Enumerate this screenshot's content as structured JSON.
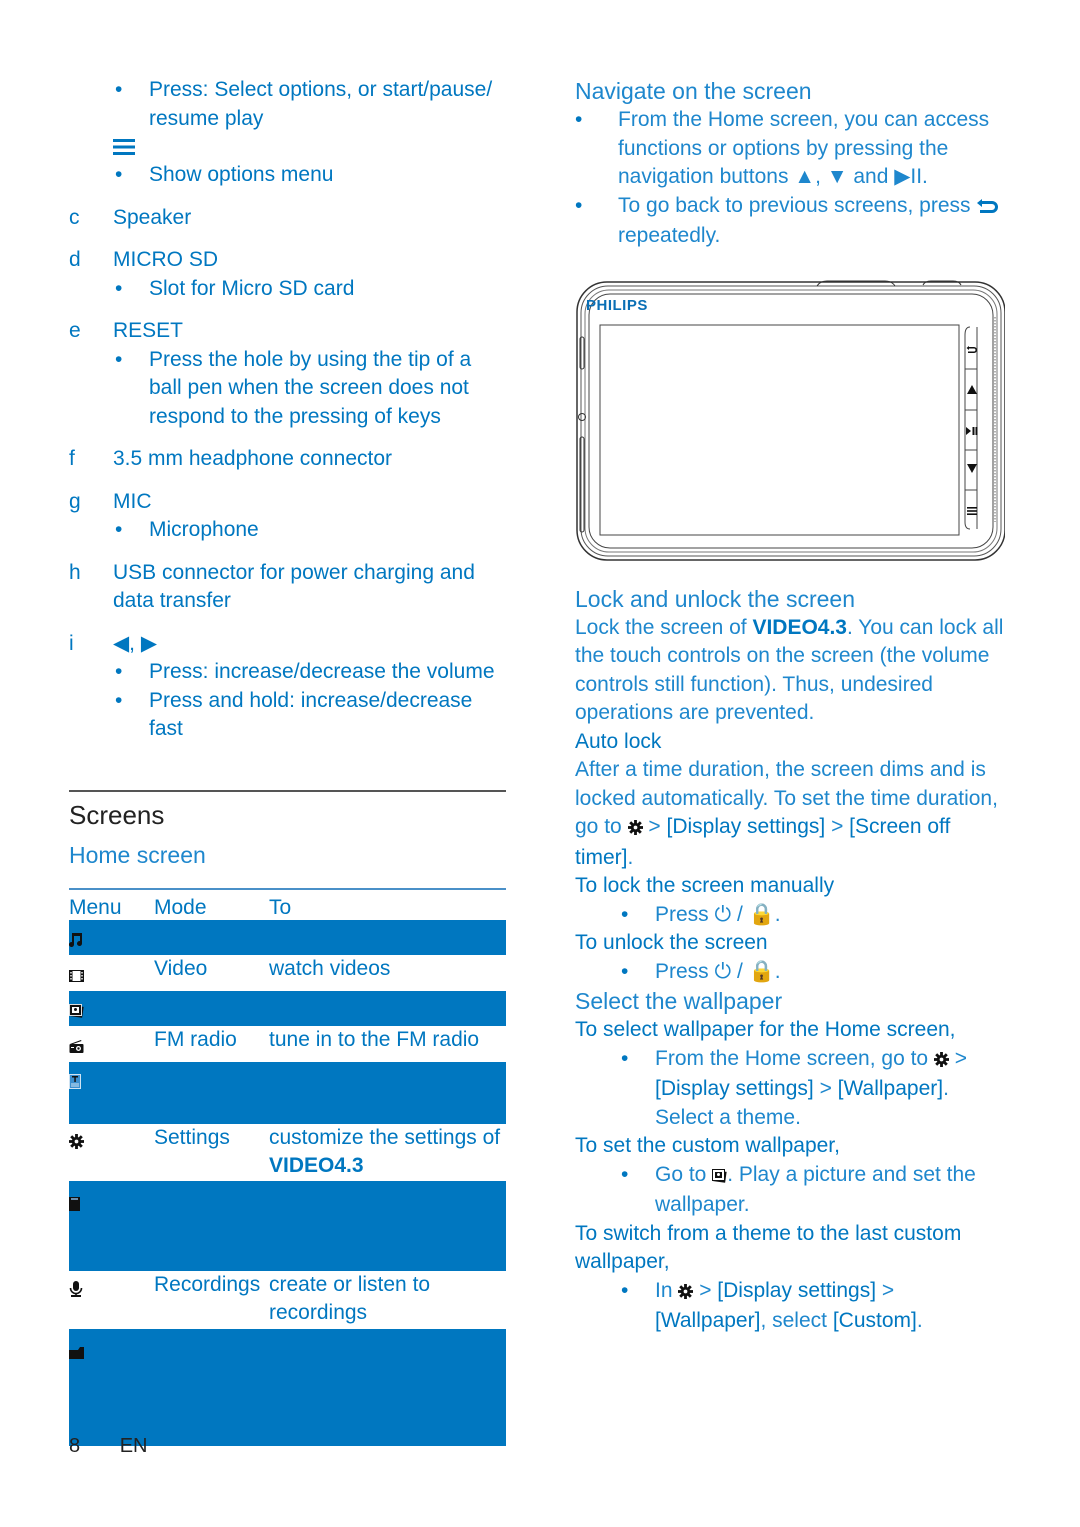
{
  "left": {
    "intro_bullets": [
      {
        "text": "Press: Select options, or start/pause/ resume play"
      }
    ],
    "menu_icon": "menu-icon",
    "menu_bullets": [
      {
        "text": "Show options menu"
      }
    ],
    "items": [
      {
        "letter": "c",
        "title": "Speaker",
        "bullets": []
      },
      {
        "letter": "d",
        "title": "MICRO SD",
        "bullets": [
          "Slot for Micro SD card"
        ]
      },
      {
        "letter": "e",
        "title": "RESET",
        "bullets": [
          "Press the hole by using the tip of a ball pen when the screen does not respond to the pressing of keys"
        ]
      },
      {
        "letter": "f",
        "title": "3.5 mm headphone connector",
        "bullets": []
      },
      {
        "letter": "g",
        "title": "MIC",
        "bullets": [
          "Microphone"
        ]
      },
      {
        "letter": "h",
        "title": "USB connector for power charging and data transfer",
        "bullets": []
      },
      {
        "letter": "i",
        "title": "◀, ▶",
        "bullets": [
          "Press: increase/decrease the volume",
          "Press and hold: increase/decrease fast"
        ]
      }
    ],
    "section_title": "Screens",
    "subsection_title": "Home screen",
    "table": {
      "headers": [
        "Menu",
        "Mode",
        "To"
      ],
      "rows": [
        {
          "icon": "music-icon",
          "mode": "",
          "to": "",
          "highlighted": true
        },
        {
          "icon": "video-icon",
          "mode": "Video",
          "to": "watch videos",
          "highlighted": false
        },
        {
          "icon": "pictures-icon",
          "mode": "",
          "to": "",
          "highlighted": true
        },
        {
          "icon": "radio-icon",
          "mode": "FM radio",
          "to": "tune in to the FM radio",
          "highlighted": false
        },
        {
          "icon": "text-reader-icon",
          "mode": "",
          "to": "",
          "highlighted": true
        },
        {
          "icon": "settings-icon",
          "mode": "Settings",
          "to": "customize the settings of",
          "to_bold": "VIDEO4.3",
          "highlighted": false
        },
        {
          "icon": "sd-card-icon",
          "mode": "",
          "to": "",
          "highlighted": true
        },
        {
          "icon": "microphone-icon",
          "mode": "Recordings",
          "to": "create or listen to recordings",
          "highlighted": false
        },
        {
          "icon": "folder-icon",
          "mode": "",
          "to": "",
          "highlighted": true
        }
      ]
    }
  },
  "right": {
    "navigate": {
      "title": "Navigate on the screen",
      "bullet1": "From the Home screen, you can access functions or options by pressing the navigation buttons ▲, ▼ and ▶II.",
      "bullet2_a": "To go back to previous screens, press",
      "bullet2_b": "repeatedly."
    },
    "device": {
      "brand": "PHILIPS",
      "side_buttons": [
        "back-icon",
        "up-icon",
        "play-pause-icon",
        "down-icon",
        "menu-icon"
      ]
    },
    "lock": {
      "title": "Lock and unlock the screen",
      "p1_a": "Lock the screen of ",
      "p1_bold": "VIDEO4.3",
      "p1_b": ". You can lock all the touch controls on the screen (the volume controls still function). Thus, undesired operations are prevented.",
      "auto_title": "Auto lock",
      "auto_p_a": "After a time duration, the screen dims and is locked automatically. To set the time duration, go to",
      "auto_p_b1": "[Display settings]",
      "auto_p_b2": "[Screen off timer]",
      "manual_title": "To lock the screen manually",
      "manual_bullet": "Press ⏻ / 🔒.",
      "unlock_title": "To unlock the screen",
      "unlock_bullet": "Press ⏻ / 🔒."
    },
    "wallpaper": {
      "title": "Select the wallpaper",
      "home_title": "To select wallpaper for the Home screen,",
      "home_bullet_a": "From the Home screen, go to",
      "home_bullet_b1": "[Display settings]",
      "home_bullet_b2": "[Wallpaper]",
      "home_bullet_c": "Select a theme.",
      "custom_title": "To set the custom wallpaper,",
      "custom_bullet_a": "Go to",
      "custom_bullet_b": ". Play a picture and set the wallpaper.",
      "switch_title": "To switch from a theme to the last custom wallpaper,",
      "switch_bullet_a": "In",
      "switch_bullet_b1": "[Display settings]",
      "switch_bullet_b2": "[Wallpaper]",
      "switch_bullet_c": ", select ",
      "switch_bullet_b3": "[Custom]"
    }
  },
  "footer": {
    "page": "8",
    "lang": "EN"
  },
  "colors": {
    "accent": "#0077c0",
    "heading": "#1e87cd",
    "text_dark": "#222222"
  }
}
